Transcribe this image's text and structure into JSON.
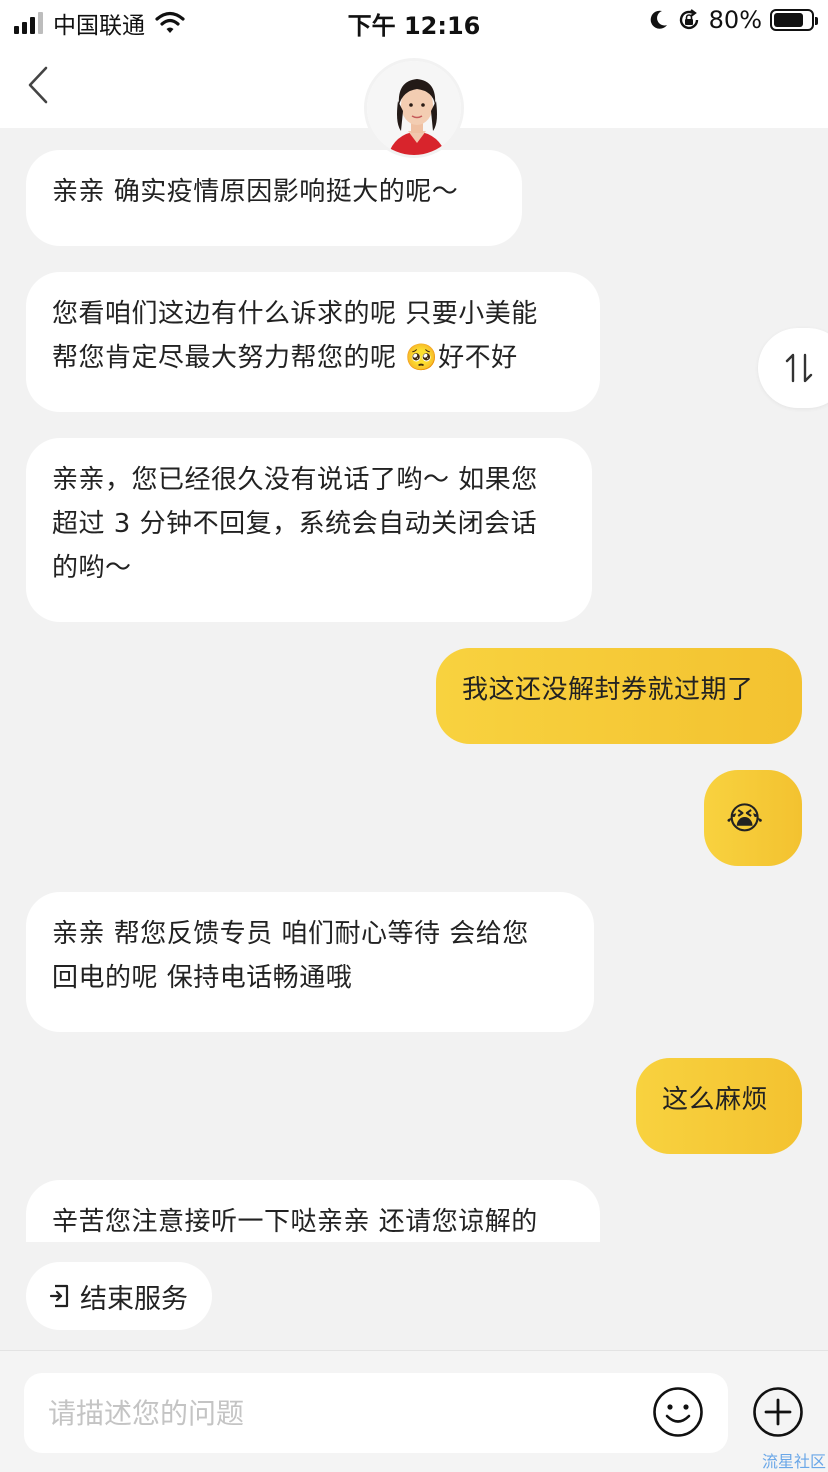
{
  "status_bar": {
    "carrier": "中国联通",
    "time": "下午 12:16",
    "battery": "80%",
    "battery_level": 0.8
  },
  "messages": [
    {
      "side": "in",
      "text": "亲亲 确实疫情原因影响挺大的呢～"
    },
    {
      "side": "in",
      "text": "您看咱们这边有什么诉求的呢 只要小美能\n帮您肯定尽最大努力帮您的呢 🥺好不好"
    },
    {
      "side": "in",
      "text": "亲亲，您已经很久没有说话了哟～ 如果您\n超过 3 分钟不回复，系统会自动关闭会话\n的哟～"
    },
    {
      "side": "out",
      "text": "我这还没解封券就过期了"
    },
    {
      "side": "out",
      "text": "😭"
    },
    {
      "side": "in",
      "text": "亲亲 帮您反馈专员  咱们耐心等待 会给您\n回电的呢 保持电话畅通哦"
    },
    {
      "side": "out",
      "text": "这么麻烦"
    },
    {
      "side": "in",
      "text": "辛苦您注意接听一下哒亲亲 还请您谅解的"
    }
  ],
  "end_service": "结束服务",
  "input": {
    "placeholder": "请描述您的问题"
  },
  "watermark": "流星社区",
  "colors": {
    "outgoing_bubble": "#f5c833",
    "background": "#f2f2f2"
  }
}
